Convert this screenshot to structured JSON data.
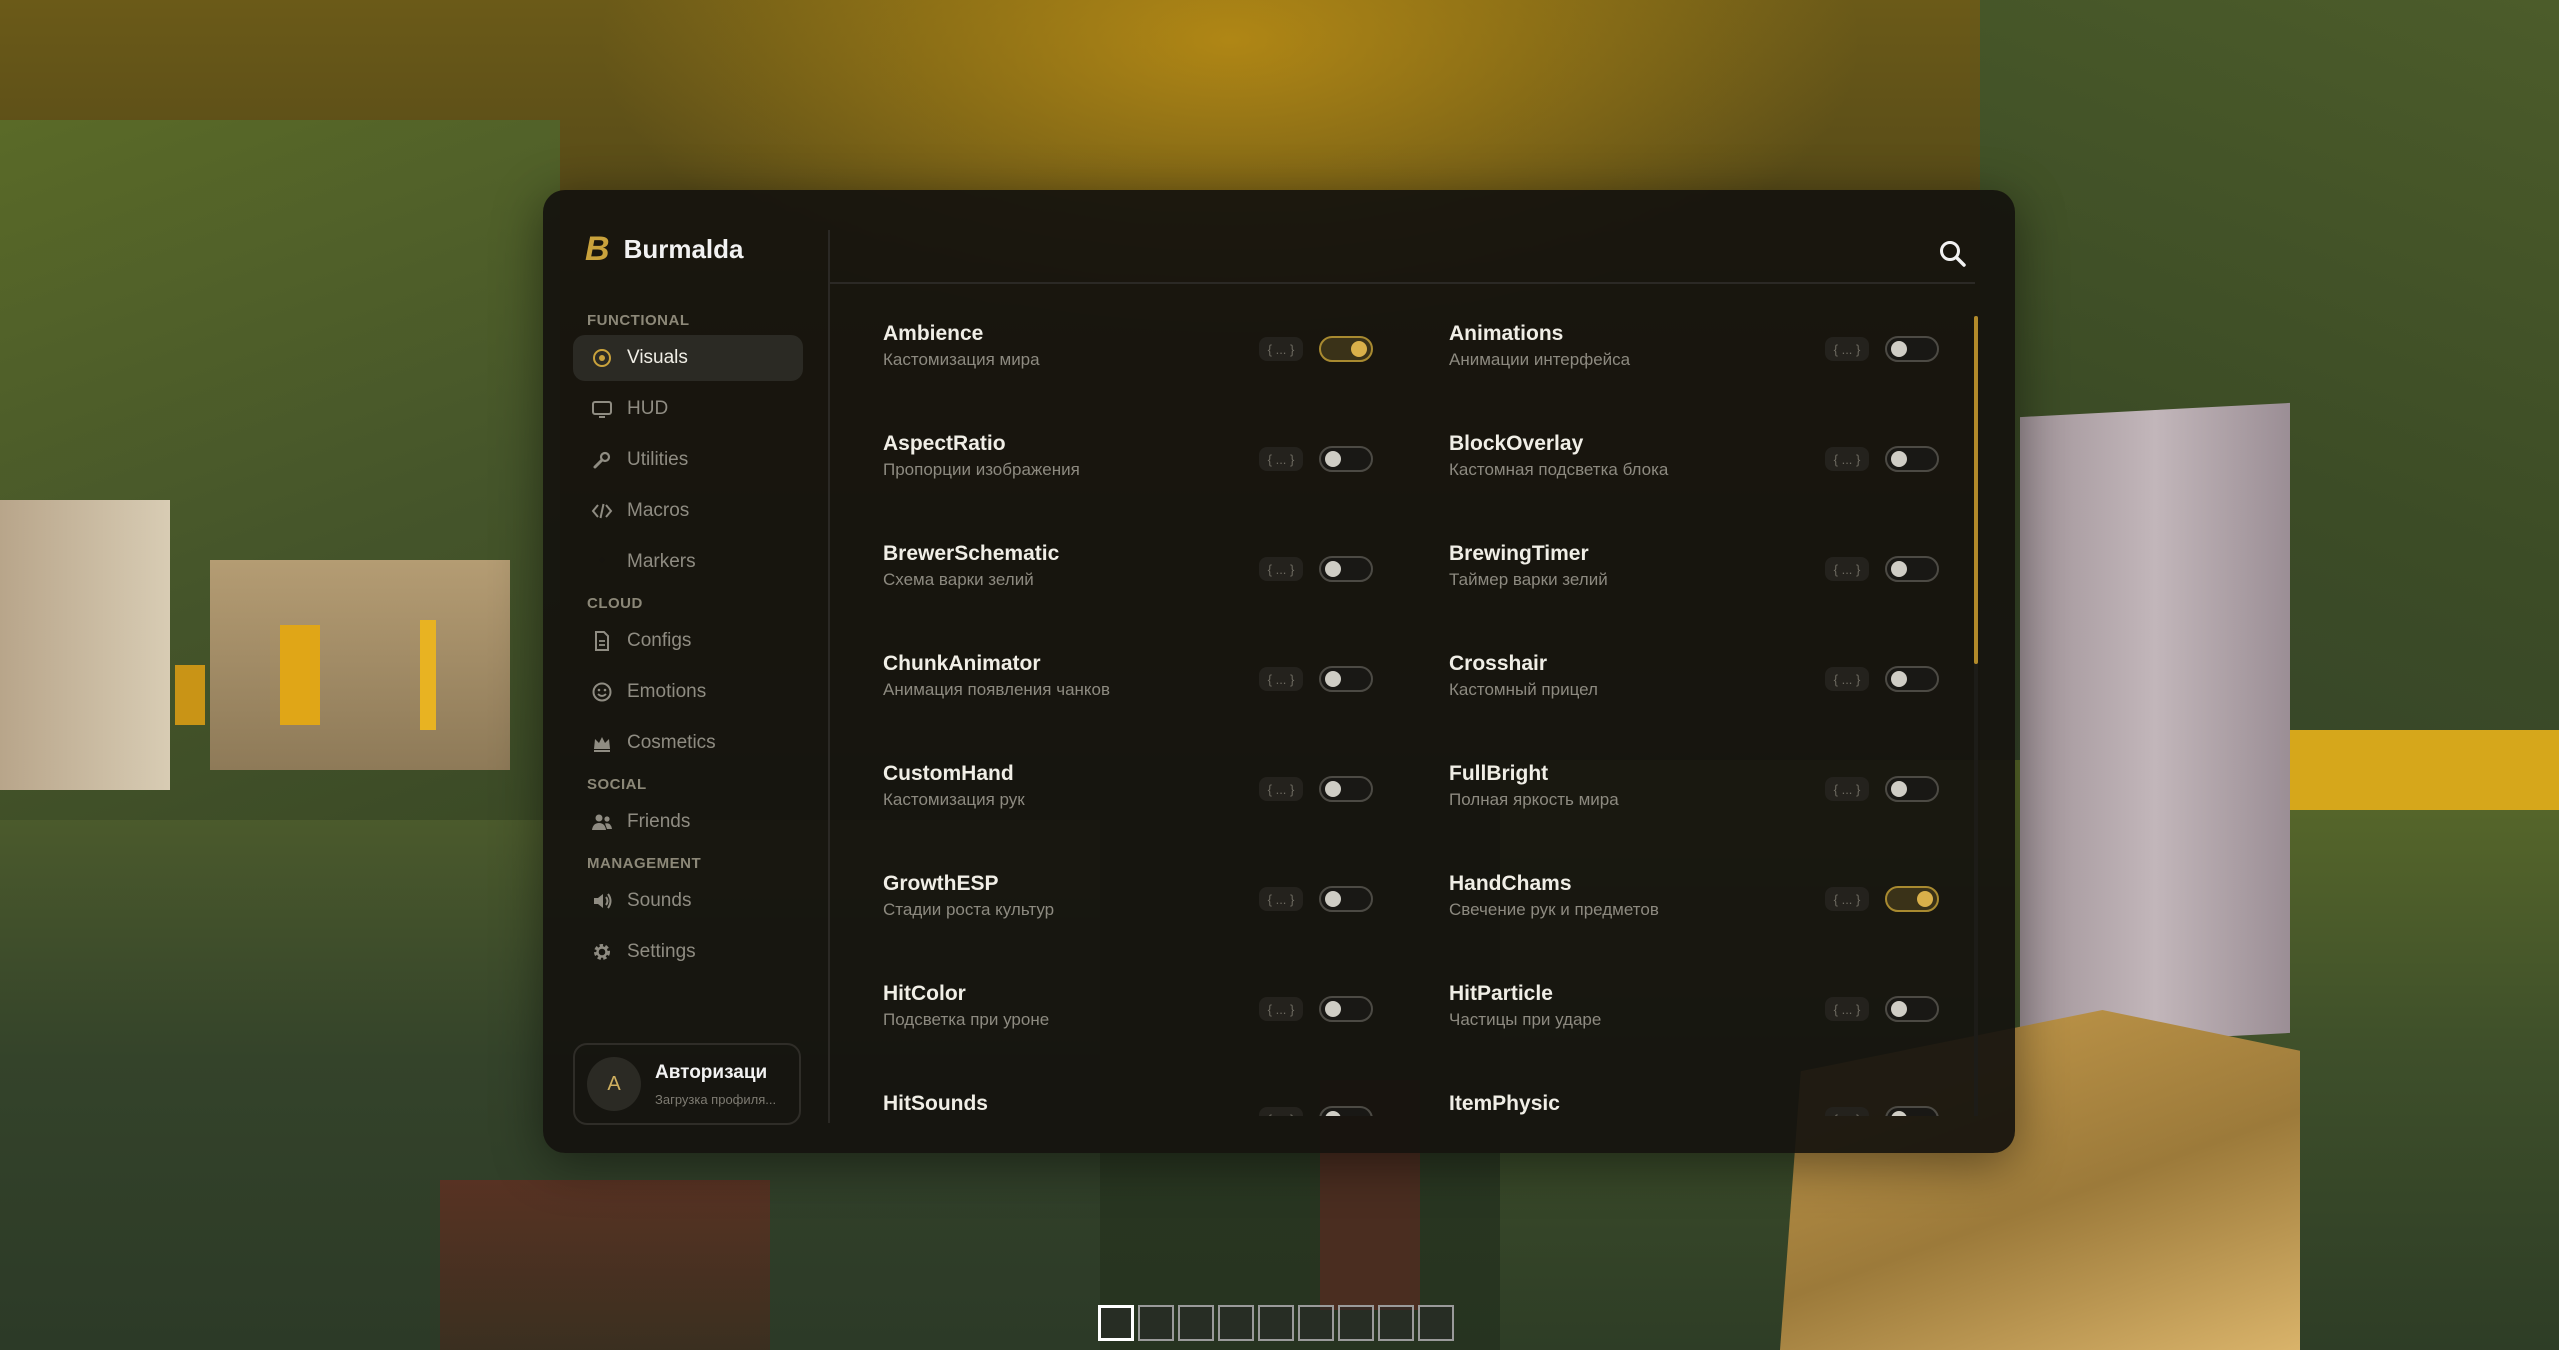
{
  "brand": {
    "mark": "B",
    "name": "Burmalda"
  },
  "colors": {
    "accent": "#c9a23c",
    "panel": "#16140f",
    "toggle_on": "#d9b04a"
  },
  "sidebar": {
    "sections": [
      {
        "title": "FUNCTIONAL",
        "items": [
          {
            "label": "Visuals",
            "icon": "eye-icon",
            "active": true
          },
          {
            "label": "HUD",
            "icon": "monitor-icon"
          },
          {
            "label": "Utilities",
            "icon": "wrench-icon"
          },
          {
            "label": "Macros",
            "icon": "code-icon"
          },
          {
            "label": "Markers",
            "icon": "map-pin-icon"
          }
        ]
      },
      {
        "title": "CLOUD",
        "items": [
          {
            "label": "Configs",
            "icon": "file-icon"
          },
          {
            "label": "Emotions",
            "icon": "smile-icon"
          },
          {
            "label": "Cosmetics",
            "icon": "crown-icon"
          }
        ]
      },
      {
        "title": "SOCIAL",
        "items": [
          {
            "label": "Friends",
            "icon": "users-icon"
          }
        ]
      },
      {
        "title": "MANAGEMENT",
        "items": [
          {
            "label": "Sounds",
            "icon": "speaker-icon"
          },
          {
            "label": "Settings",
            "icon": "gear-icon"
          }
        ]
      }
    ]
  },
  "profile": {
    "avatar_letter": "A",
    "name": "Авторизаци",
    "status": "Загрузка профиля..."
  },
  "modules": [
    {
      "title": "Ambience",
      "desc": "Кастомизация мира",
      "opts": "{ ... }",
      "enabled": true
    },
    {
      "title": "Animations",
      "desc": "Анимации интерфейса",
      "opts": "{ ... }",
      "enabled": false
    },
    {
      "title": "AspectRatio",
      "desc": "Пропорции изображения",
      "opts": "{ ... }",
      "enabled": false
    },
    {
      "title": "BlockOverlay",
      "desc": "Кастомная подсветка блока",
      "opts": "{ ... }",
      "enabled": false
    },
    {
      "title": "BrewerSchematic",
      "desc": "Схема варки зелий",
      "opts": "{ ... }",
      "enabled": false
    },
    {
      "title": "BrewingTimer",
      "desc": "Таймер варки зелий",
      "opts": "{ ... }",
      "enabled": false
    },
    {
      "title": "ChunkAnimator",
      "desc": "Анимация появления чанков",
      "opts": "{ ... }",
      "enabled": false
    },
    {
      "title": "Crosshair",
      "desc": "Кастомный прицел",
      "opts": "{ ... }",
      "enabled": false
    },
    {
      "title": "CustomHand",
      "desc": "Кастомизация рук",
      "opts": "{ ... }",
      "enabled": false
    },
    {
      "title": "FullBright",
      "desc": "Полная яркость мира",
      "opts": "{ ... }",
      "enabled": false
    },
    {
      "title": "GrowthESP",
      "desc": "Стадии роста культур",
      "opts": "{ ... }",
      "enabled": false
    },
    {
      "title": "HandChams",
      "desc": "Свечение рук и предметов",
      "opts": "{ ... }",
      "enabled": true
    },
    {
      "title": "HitColor",
      "desc": "Подсветка при уроне",
      "opts": "{ ... }",
      "enabled": false
    },
    {
      "title": "HitParticle",
      "desc": "Частицы при ударе",
      "opts": "{ ... }",
      "enabled": false
    },
    {
      "title": "HitSounds",
      "desc": "",
      "opts": "{ ... }",
      "enabled": false
    },
    {
      "title": "ItemPhysic",
      "desc": "",
      "opts": "{ ... }",
      "enabled": false
    }
  ],
  "hotbar": {
    "slots": 9,
    "selected": 1
  }
}
